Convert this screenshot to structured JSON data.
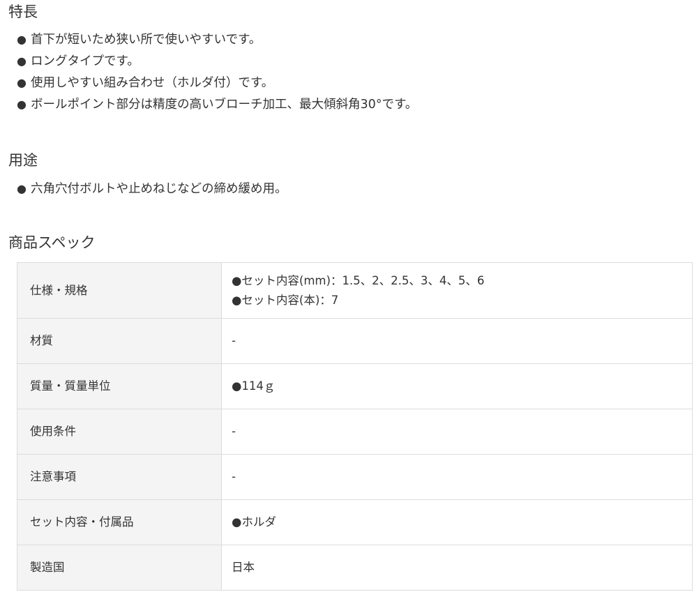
{
  "features": {
    "heading": "特長",
    "bullet": "●",
    "items": [
      "首下が短いため狭い所で使いやすいです。",
      "ロングタイプです。",
      "使用しやすい組み合わせ（ホルダ付）です。",
      "ボールポイント部分は精度の高いブローチ加工、最大傾斜角30°です。"
    ]
  },
  "uses": {
    "heading": "用途",
    "bullet": "●",
    "items": [
      "六角穴付ボルトや止めねじなどの締め緩め用。"
    ]
  },
  "spec": {
    "heading": "商品スペック",
    "rows": [
      {
        "label": "仕様・規格",
        "values": [
          "●セット内容(mm)：1.5、2、2.5、3、4、5、6",
          "●セット内容(本)：7"
        ]
      },
      {
        "label": "材質",
        "values": [
          "-"
        ]
      },
      {
        "label": "質量・質量単位",
        "values": [
          "●114ｇ"
        ]
      },
      {
        "label": "使用条件",
        "values": [
          "-"
        ]
      },
      {
        "label": "注意事項",
        "values": [
          "-"
        ]
      },
      {
        "label": "セット内容・付属品",
        "values": [
          "●ホルダ"
        ]
      },
      {
        "label": "製造国",
        "values": [
          "日本"
        ]
      }
    ]
  }
}
